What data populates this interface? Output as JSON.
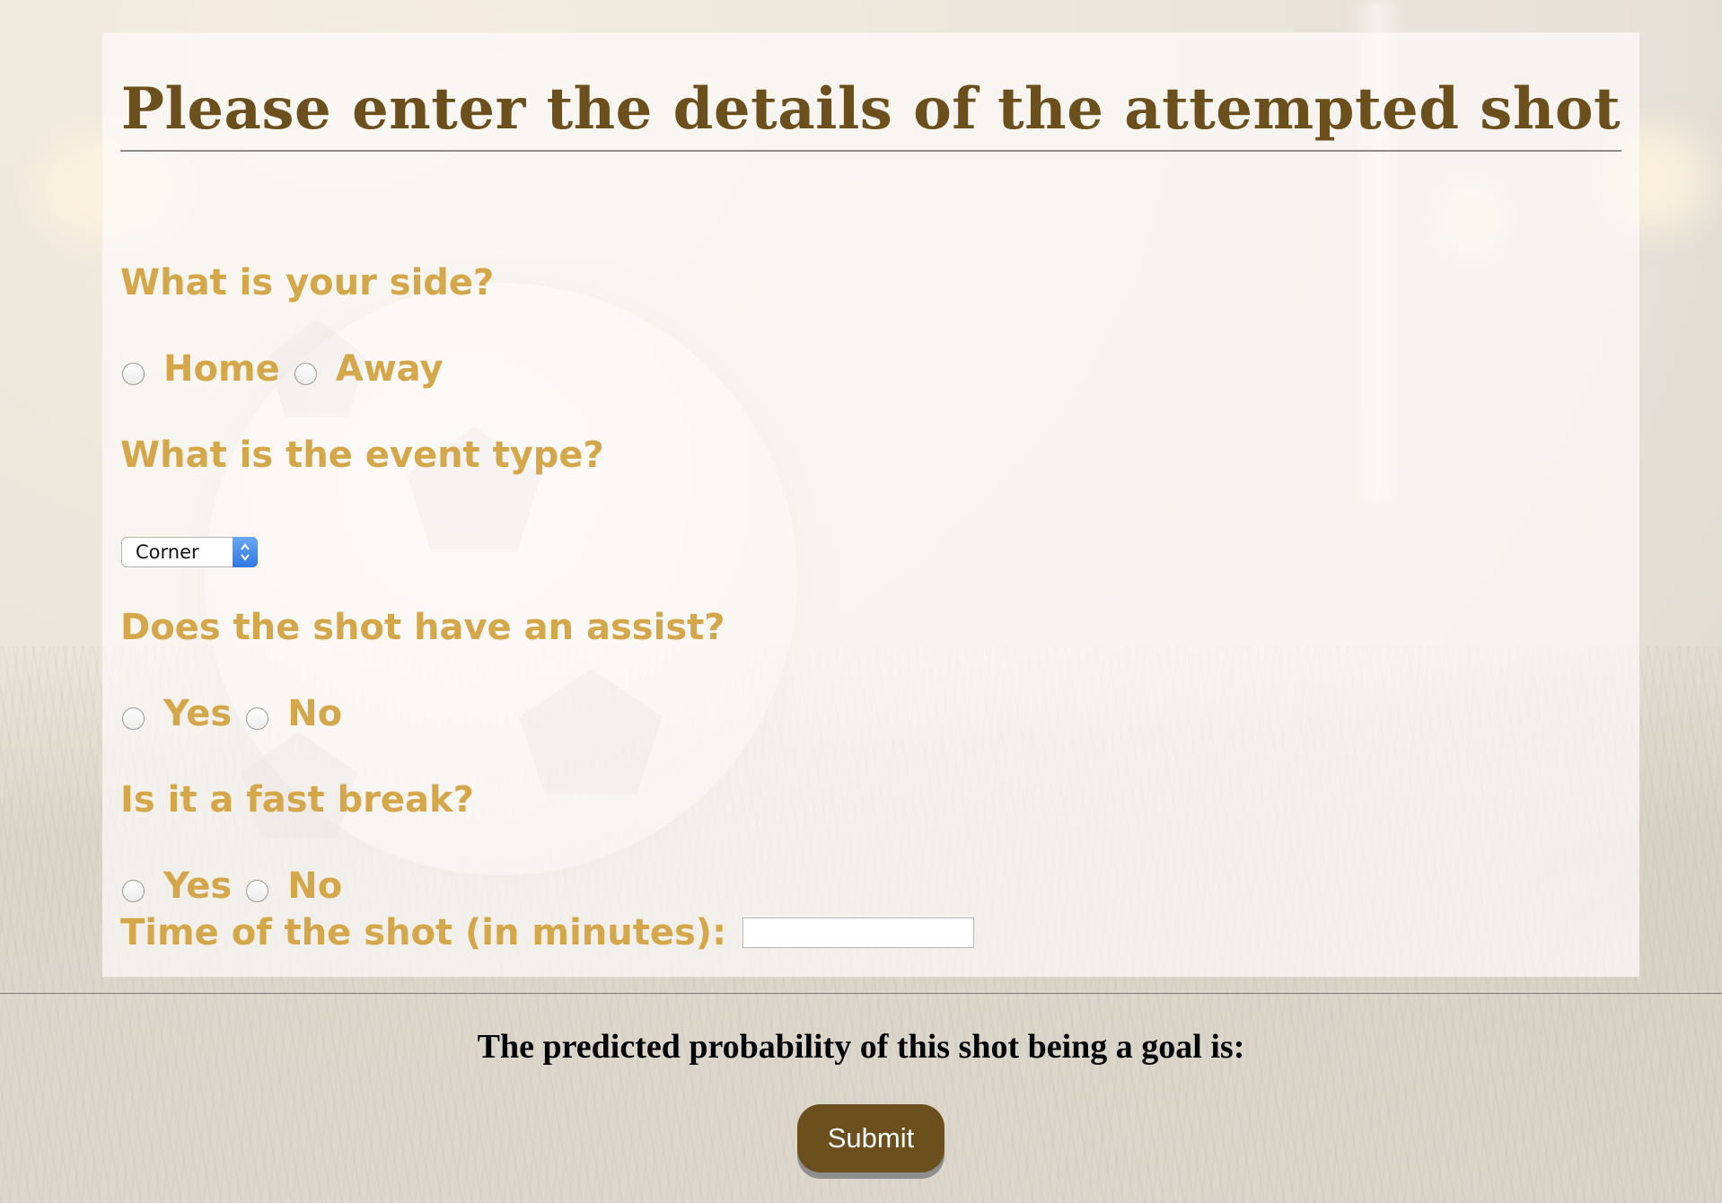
{
  "page": {
    "title": "Please enter the details of the attempted shot"
  },
  "form": {
    "side": {
      "question": "What is your side?",
      "options": [
        "Home",
        "Away"
      ]
    },
    "event_type": {
      "question": "What is the event type?",
      "selected": "Corner"
    },
    "assist": {
      "question": "Does the shot have an assist?",
      "options": [
        "Yes",
        "No"
      ]
    },
    "fast_break": {
      "question": "Is it a fast break?",
      "options": [
        "Yes",
        "No"
      ]
    },
    "time": {
      "label": "Time of the shot (in minutes):",
      "value": ""
    }
  },
  "result": {
    "text": "The predicted probability of this shot being a goal is:"
  },
  "submit": {
    "label": "Submit"
  },
  "colors": {
    "title": "#6b4f1d",
    "question": "#d3a74a",
    "button_bg": "#6b4f1d",
    "button_text": "#ffffff"
  }
}
